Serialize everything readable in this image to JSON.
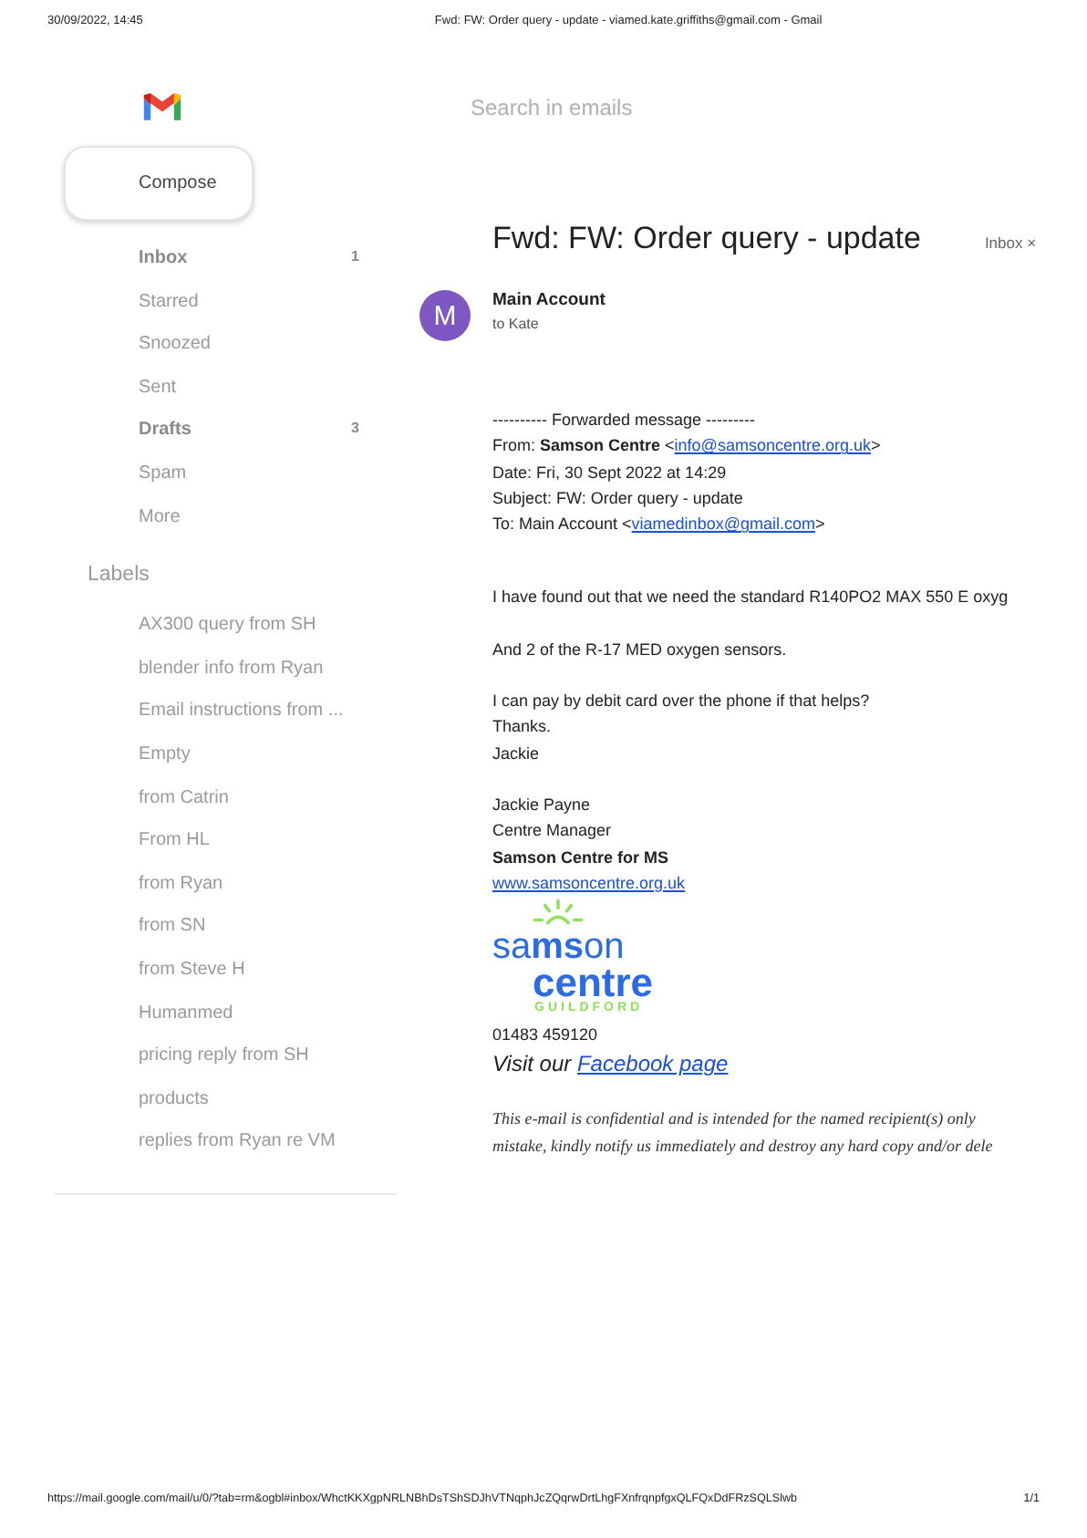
{
  "print_header": {
    "date": "30/09/2022, 14:45",
    "title": "Fwd: FW: Order query - update - viamed.kate.griffiths@gmail.com - Gmail"
  },
  "sidebar": {
    "compose": "Compose",
    "folders": [
      {
        "label": "Inbox",
        "count": "1",
        "unread": true
      },
      {
        "label": "Starred",
        "unread": false
      },
      {
        "label": "Snoozed",
        "unread": false
      },
      {
        "label": "Sent",
        "unread": false
      },
      {
        "label": "Drafts",
        "count": "3",
        "unread": true
      },
      {
        "label": "Spam",
        "unread": false
      },
      {
        "label": "More",
        "unread": false
      }
    ],
    "labels_heading": "Labels",
    "labels": [
      "AX300 query from SH",
      "blender info from Ryan",
      "Email instructions from ...",
      "Empty",
      "from Catrin",
      "From HL",
      "from Ryan",
      "from SN",
      "from Steve H",
      "Humanmed",
      "pricing reply from SH",
      "products",
      "replies from Ryan re VM"
    ]
  },
  "search": {
    "placeholder": "Search in emails"
  },
  "email": {
    "subject": "Fwd: FW: Order query - update",
    "tag": "Inbox",
    "tag_close": "×",
    "avatar": "M",
    "sender": "Main Account",
    "recipient": "to Kate",
    "forwarded": [
      {
        "kind": "text",
        "text": "---------- Forwarded message ---------"
      },
      {
        "kind": "link",
        "before": "From: **Samson Centre** <",
        "link": "info@samsoncentre.org.uk",
        "after": ">"
      },
      {
        "kind": "text",
        "text": "Date: Fri, 30 Sept 2022 at 14:29"
      },
      {
        "kind": "text",
        "text": "Subject: FW: Order query - update"
      },
      {
        "kind": "link",
        "before": "To: Main Account <",
        "link": "viamedinbox@gmail.com",
        "after": ">"
      }
    ],
    "paragraphs": [
      [
        "I have found out that we need the standard R140PO2 MAX 550 E oxyg"
      ],
      [
        "And 2 of the R-17 MED oxygen sensors."
      ],
      [
        "I can pay by debit card over the phone if that helps?",
        "Thanks.",
        "Jackie"
      ]
    ],
    "signature": [
      {
        "kind": "text",
        "text": "Jackie Payne"
      },
      {
        "kind": "text",
        "text": "Centre Manager"
      },
      {
        "kind": "bold",
        "text": "Samson Centre for MS"
      },
      {
        "kind": "link",
        "text": "www.samsoncentre.org.uk"
      },
      {
        "kind": "logo",
        "word1": "sa**ms**on",
        "word2": "centre",
        "place": "GUILDFORD"
      },
      {
        "kind": "text",
        "text": "01483 459120"
      },
      {
        "kind": "visit",
        "text": "Visit our",
        "link": "Facebook page"
      }
    ],
    "disclaimer": [
      "This e-mail is confidential and is intended for the named recipient(s) only",
      "mistake, kindly notify us immediately and destroy any hard copy and/or dele"
    ]
  },
  "print_footer": {
    "url": "https://mail.google.com/mail/u/0/?tab=rm&ogbl#inbox/WhctKKXgpNRLNBhDsTShSDJhVTNqphJcZQqrwDrtLhgFXnfrqnpfgxQLFQxDdFRzSQLSlwb",
    "page": "1/1"
  }
}
